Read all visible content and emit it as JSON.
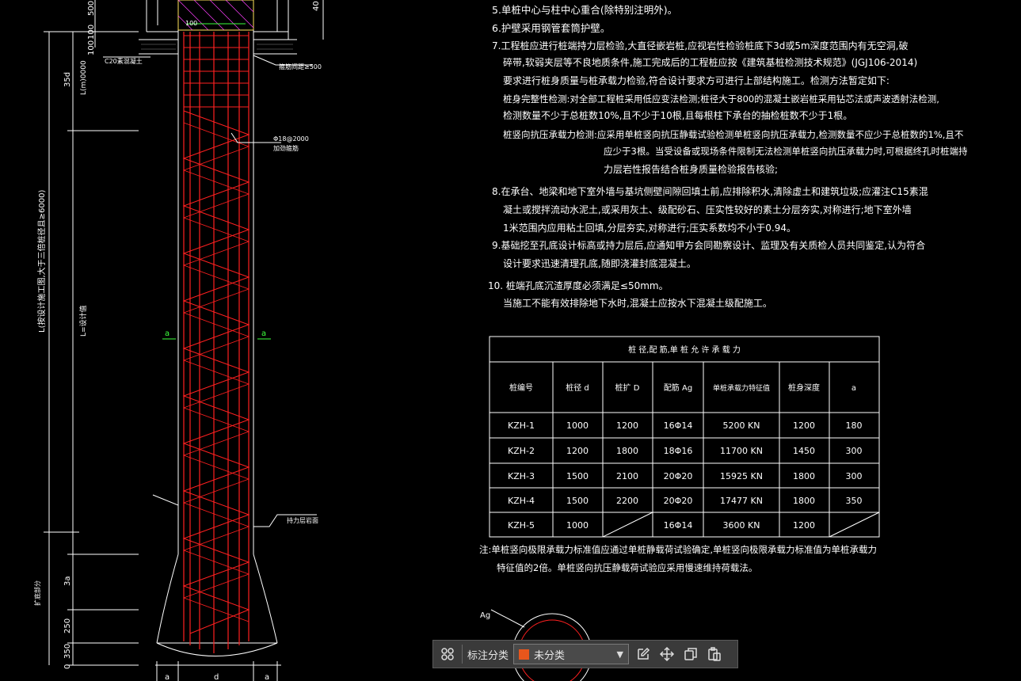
{
  "notes": {
    "n5": "5.单桩中心与柱中心重合(除特别注明外)。",
    "n6": "6.护壁采用钢管套筒护壁。",
    "n7a": "7.工程桩应进行桩端持力层检验,大直径嵌岩桩,应视岩性检验桩底下3d或5m深度范围内有无空洞,破",
    "n7b": "碎带,软弱夹层等不良地质条件,施工完成后的工程桩应按《建筑基桩检测技术规范》(JGJ106-2014)",
    "n7c": "要求进行桩身质量与桩承载力检验,符合设计要求方可进行上部结构施工。检测方法暂定如下:",
    "n7d": "桩身完整性检测:对全部工程桩采用低应变法检测;桩径大于800的混凝土嵌岩桩采用钻芯法或声波透射法检测,",
    "n7e": "检测数量不少于总桩数10%,且不少于10根,且每根柱下承台的抽检桩数不少于1根。",
    "n7f": "桩竖向抗压承载力检测:应采用单桩竖向抗压静载试验检测单桩竖向抗压承载力,检测数量不应少于总桩数的1%,且不",
    "n7g": "应少于3根。当受设备或现场条件限制无法检测单桩竖向抗压承载力时,可根据终孔时桩端持",
    "n7h": "力层岩性报告结合桩身质量检验报告核验;",
    "n8a": "8.在承台、地梁和地下室外墙与基坑侧壁间隙回填土前,应排除积水,清除虚土和建筑垃圾;应灌注C15素混",
    "n8b": "凝土或搅拌流动水泥土,或采用灰土、级配砂石、压实性较好的素土分层夯实,对称进行;地下室外墙",
    "n8c": "1米范围内应用粘土回填,分层夯实,对称进行;压实系数均不小于0.94。",
    "n9a": "9.基础挖至孔底设计标高或持力层后,应通知甲方会同勘察设计、监理及有关质检人员共同鉴定,认为符合",
    "n9b": "设计要求迅速清理孔底,随即浇灌封底混凝土。",
    "n10a": "10. 桩端孔底沉渣厚度必须满足≤50mm。",
    "n10b": "当施工不能有效排除地下水时,混凝土应按水下混凝土级配施工。"
  },
  "table": {
    "title": "桩 径,配 筋,单 桩 允 许 承 载 力",
    "headers": [
      "桩编号",
      "桩径 d",
      "桩扩 D",
      "配筋 Ag",
      "单桩承载力特征值",
      "桩身深度",
      "a"
    ],
    "rows": [
      [
        "KZH-1",
        "1000",
        "1200",
        "16Φ14",
        "5200 KN",
        "1200",
        "180"
      ],
      [
        "KZH-2",
        "1200",
        "1800",
        "18Φ16",
        "11700 KN",
        "1450",
        "300"
      ],
      [
        "KZH-3",
        "1500",
        "2100",
        "20Φ20",
        "15925 KN",
        "1800",
        "300"
      ],
      [
        "KZH-4",
        "1500",
        "2200",
        "20Φ20",
        "17477 KN",
        "1800",
        "350"
      ],
      [
        "KZH-5",
        "1000",
        "",
        "16Φ14",
        "3600 KN",
        "1200",
        ""
      ]
    ],
    "note_a": "注:单桩竖向极限承载力标准值应通过单桩静载荷试验确定,单桩竖向极限承载力标准值为单桩承载力",
    "note_b": "特征值的2倍。单桩竖向抗压静载荷试验应采用慢速维持荷载法。"
  },
  "drawing": {
    "dim_500": "500",
    "dim_100a": "100",
    "dim_100b": "100",
    "dim_35d": "35d",
    "dim_lm": "L(m)0000",
    "dim_l": "L(按设计施工图,大于三倍桩径且≥6000)",
    "dim_l_sub": "L=设计值",
    "dim_3a": "3a",
    "dim_250": "250",
    "dim_350": "350",
    "dim_0": "0",
    "dim_40": "40",
    "label_c20": "C20素混凝土",
    "label_spiral_top": "Φ18@2000",
    "label_spiral_top2": "加劲箍筋",
    "label_top_right": "箍筋间距≥500",
    "label_right_mid": "持力层岩面",
    "label_left_bottom": "扩底部分",
    "label_ag": "Ag",
    "label_a1": "a",
    "label_d": "d",
    "label_a2": "a",
    "label_a_left": "a",
    "label_a_right": "a",
    "label_100": "100"
  },
  "toolbar": {
    "label": "标注分类",
    "select_value": "未分类",
    "swatch_color": "#e8561c"
  }
}
